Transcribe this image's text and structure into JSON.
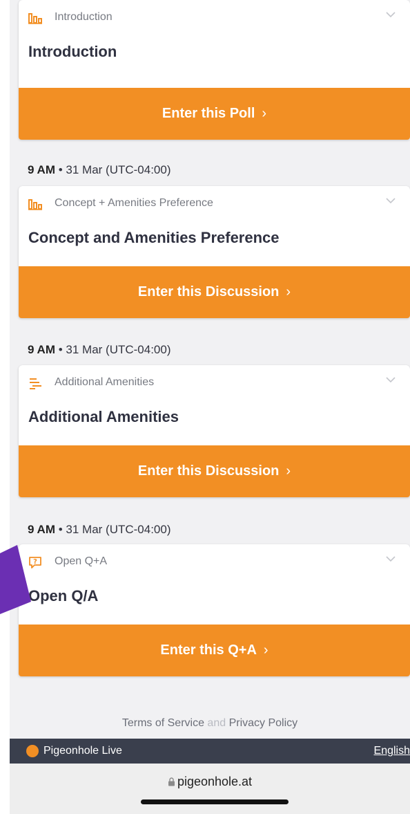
{
  "cards": [
    {
      "type_label": "Introduction",
      "icon": "bar-chart-icon",
      "title": "Introduction",
      "action_label": "Enter this Poll",
      "arrow": "›"
    },
    {
      "type_label": "Concept + Amenities Preference",
      "icon": "bar-chart-icon",
      "title": "Concept and Amenities Preference",
      "action_label": "Enter this Discussion",
      "arrow": "›"
    },
    {
      "type_label": "Additional Amenities",
      "icon": "discussion-bars-icon",
      "title": "Additional Amenities",
      "action_label": "Enter this Discussion",
      "arrow": "›"
    },
    {
      "type_label": "Open Q+A",
      "icon": "question-bubble-icon",
      "title": "Open Q/A",
      "action_label": "Enter this Q+A",
      "arrow": "›"
    }
  ],
  "times": [
    {
      "time": "9 AM",
      "date": " • 31 Mar (UTC-04:00)"
    },
    {
      "time": "9 AM",
      "date": " • 31 Mar (UTC-04:00)"
    },
    {
      "time": "9 AM",
      "date": " • 31 Mar (UTC-04:00)"
    }
  ],
  "footer": {
    "terms": "Terms of Service",
    "and": " and ",
    "privacy": "Privacy Policy"
  },
  "brand": {
    "name": "Pigeonhole Live",
    "language": "English"
  },
  "browser": {
    "url": "pigeonhole.at"
  },
  "colors": {
    "accent": "#f28f24",
    "annotation_arrow": "#6b2fb3",
    "brand_bar": "#3a3f4d"
  }
}
